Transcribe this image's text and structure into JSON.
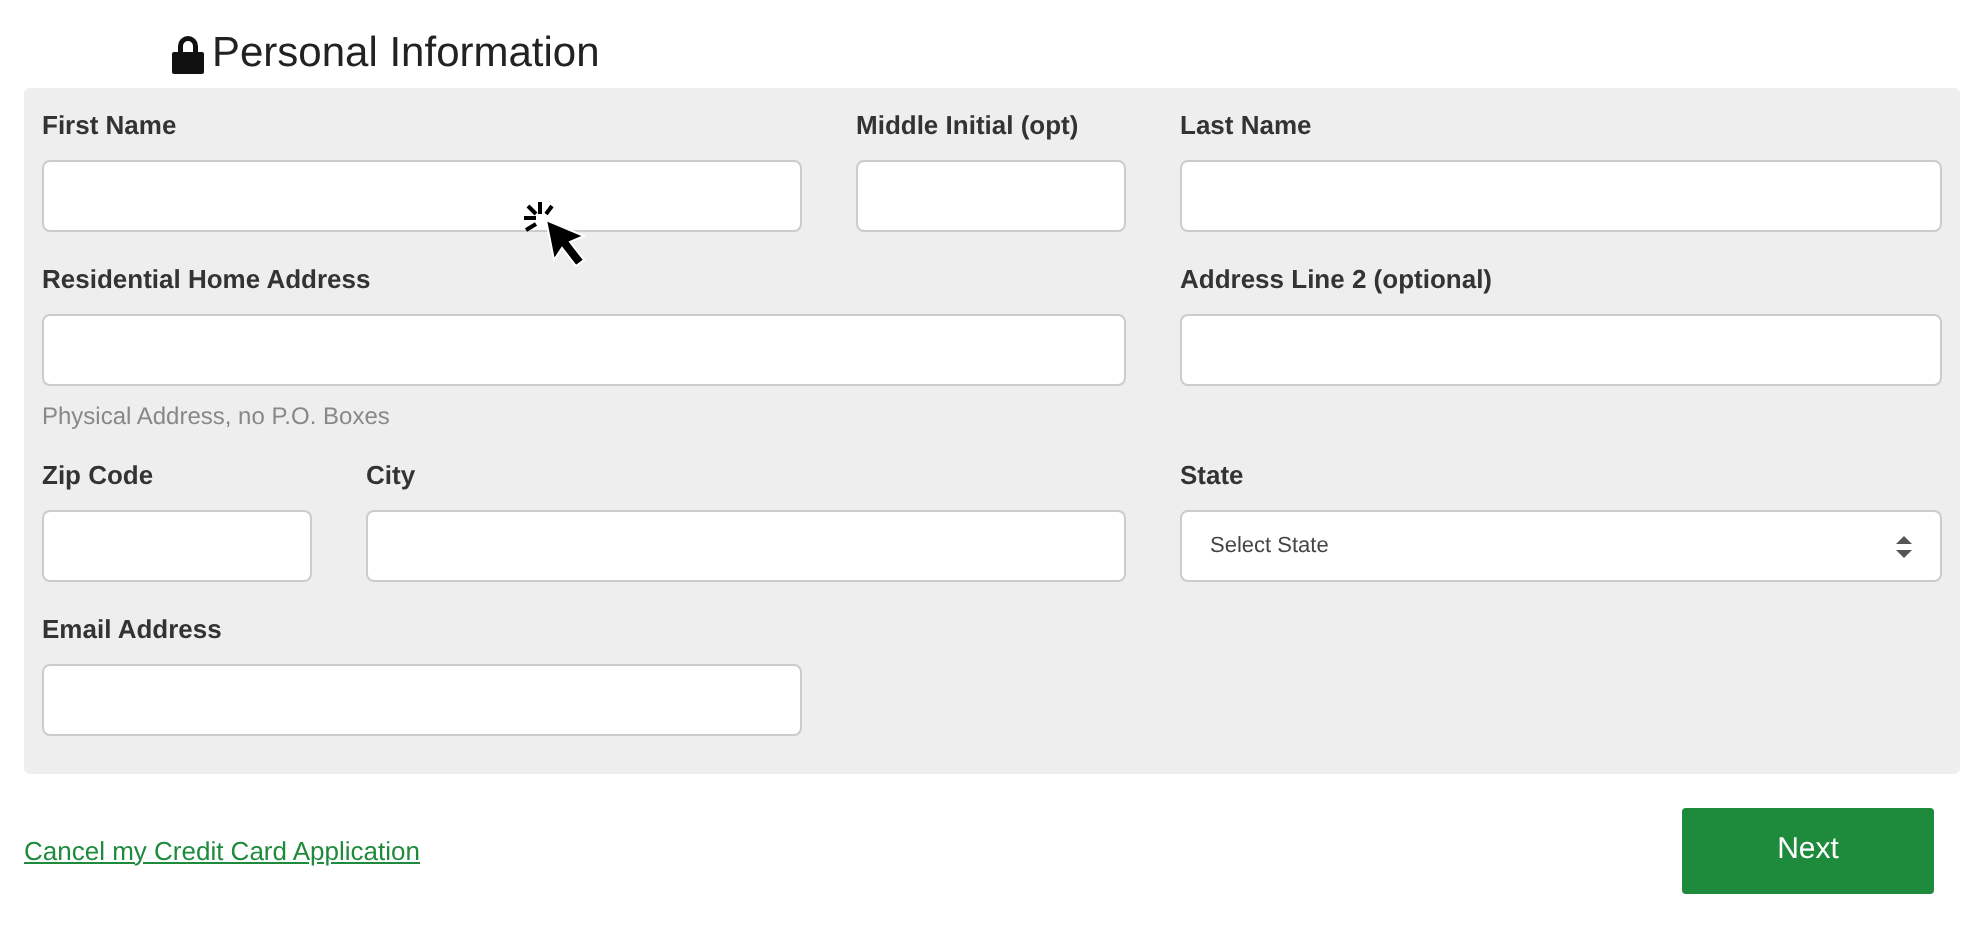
{
  "title": "Personal Information",
  "form_rows": [
    {
      "fields": [
        {
          "kind": "text",
          "label": "First Name"
        },
        {
          "kind": "text",
          "label": "Middle Initial (opt)"
        },
        {
          "kind": "text",
          "label": "Last Name"
        }
      ]
    },
    {
      "fields": [
        {
          "kind": "text",
          "label": "Residential Home Address",
          "help": "Physical Address, no P.O. Boxes"
        },
        {
          "kind": "text",
          "label": "Address Line 2 (optional)"
        }
      ]
    },
    {
      "fields": [
        {
          "kind": "text",
          "label": "Zip Code"
        },
        {
          "kind": "text",
          "label": "City"
        },
        {
          "kind": "select",
          "label": "State",
          "value": "Select State"
        }
      ]
    },
    {
      "fields": [
        {
          "kind": "text",
          "label": "Email Address"
        }
      ]
    }
  ],
  "cancel_link": "Cancel my Credit Card Application",
  "next_button": "Next"
}
